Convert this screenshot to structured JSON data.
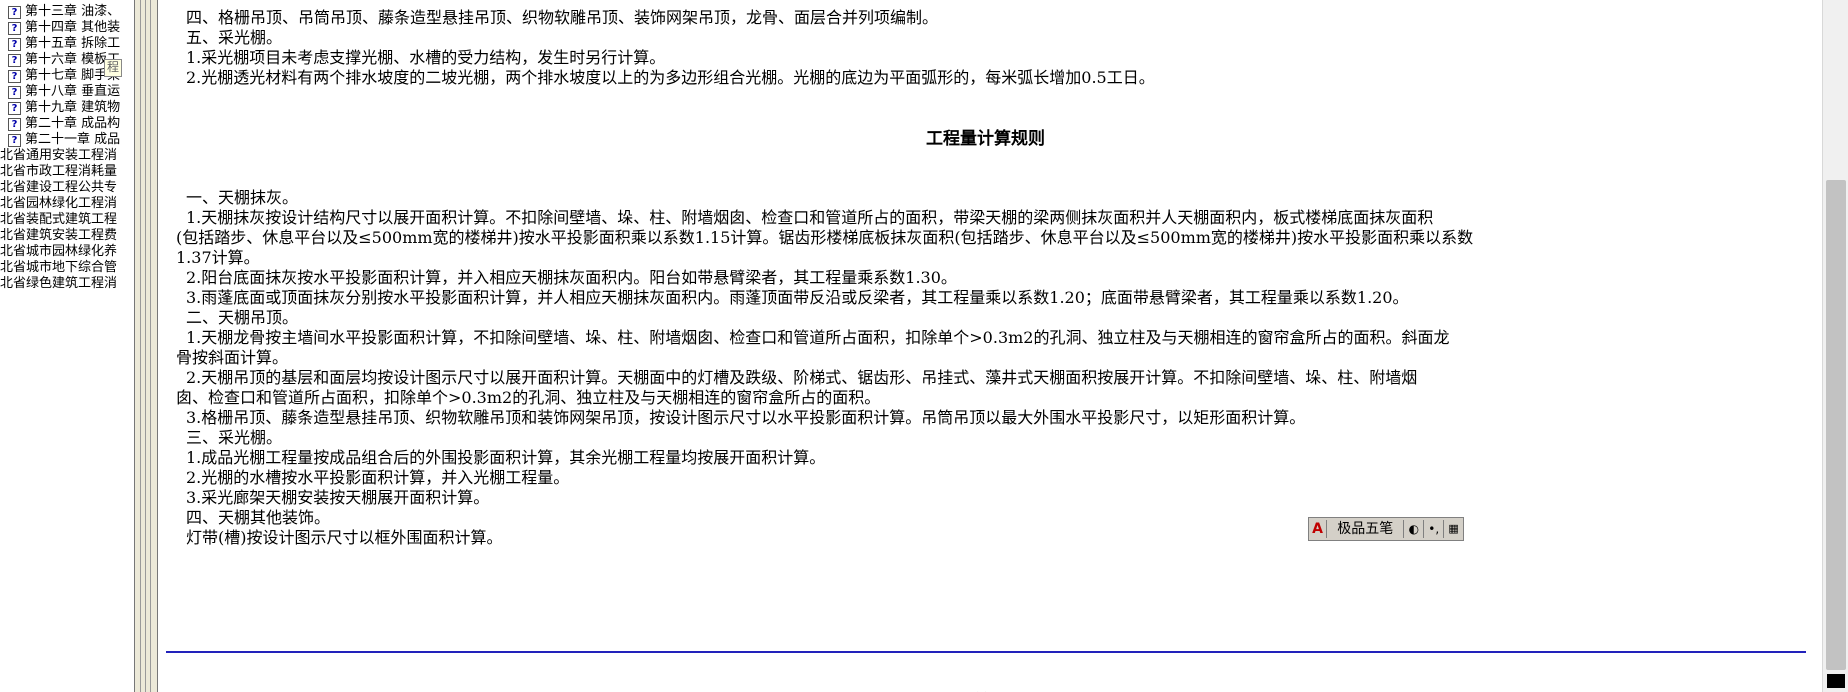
{
  "tree": {
    "chapters": [
      "第十三章 油漆、",
      "第十四章 其他装",
      "第十五章 拆除工",
      "第十六章 模板工",
      "第十七章 脚手架",
      "第十八章 垂直运",
      "第十九章 建筑物",
      "第二十章 成品构",
      "第二十一章 成品"
    ],
    "tooltip": "程",
    "provinces": [
      "北省通用安装工程消",
      "北省市政工程消耗量",
      "北省建设工程公共专",
      "北省园林绿化工程消",
      "北省装配式建筑工程",
      "北省建筑安装工程费",
      "北省城市园林绿化养",
      "北省城市地下综合管",
      "北省绿色建筑工程消"
    ]
  },
  "doc": {
    "lines": [
      "四、格栅吊顶、吊筒吊顶、藤条造型悬挂吊顶、织物软雕吊顶、装饰网架吊顶，龙骨、面层合并列项编制。",
      "五、采光棚。",
      "1.采光棚项目未考虑支撑光棚、水槽的受力结构，发生时另行计算。",
      "2.光棚透光材料有两个排水坡度的二坡光棚，两个排水坡度以上的为多边形组合光棚。光棚的底边为平面弧形的，每米弧长增加0.5工日。",
      "工程量计算规则",
      "一、天棚抹灰。",
      "1.天棚抹灰按设计结构尺寸以展开面积计算。不扣除间壁墙、垛、柱、附墙烟囱、检查口和管道所占的面积，带梁天棚的梁两侧抹灰面积并人天棚面积内，板式楼梯底面抹灰面积",
      "(包括踏步、休息平台以及≤500mm宽的楼梯井)按水平投影面积乘以系数1.15计算。锯齿形楼梯底板抹灰面积(包括踏步、休息平台以及≤500mm宽的楼梯井)按水平投影面积乘以系数",
      "1.37计算。",
      "2.阳台底面抹灰按水平投影面积计算，并入相应天棚抹灰面积内。阳台如带悬臂梁者，其工程量乘系数1.30。",
      "3.雨蓬底面或顶面抹灰分别按水平投影面积计算，并人相应天棚抹灰面积内。雨蓬顶面带反沿或反梁者，其工程量乘以系数1.20；底面带悬臂梁者，其工程量乘以系数1.20。",
      "二、天棚吊顶。",
      "1.天棚龙骨按主墙间水平投影面积计算，不扣除间壁墙、垛、柱、附墙烟囱、检查口和管道所占面积，扣除单个>0.3m2的孔洞、独立柱及与天棚相连的窗帘盒所占的面积。斜面龙",
      "骨按斜面计算。",
      "2.天棚吊顶的基层和面层均按设计图示尺寸以展开面积计算。天棚面中的灯槽及跌级、阶梯式、锯齿形、吊挂式、藻井式天棚面积按展开计算。不扣除间壁墙、垛、柱、附墙烟",
      "囱、检查口和管道所占面积，扣除单个>0.3m2的孔洞、独立柱及与天棚相连的窗帘盒所占的面积。",
      "3.格栅吊顶、藤条造型悬挂吊顶、织物软雕吊顶和装饰网架吊顶，按设计图示尺寸以水平投影面积计算。吊筒吊顶以最大外围水平投影尺寸，以矩形面积计算。",
      "三、采光棚。",
      "1.成品光棚工程量按成品组合后的外围投影面积计算，其余光棚工程量均按展开面积计算。",
      "2.光棚的水槽按水平投影面积计算，并入光棚工程量。",
      "3.采光廊架天棚安装按天棚展开面积计算。",
      "四、天棚其他装饰。",
      "灯带(槽)按设计图示尺寸以框外围面积计算。"
    ],
    "bottom_mark": "· ·"
  },
  "ime": {
    "mode": "A",
    "name": "极品五笔",
    "moon": "◐",
    "punct": "•,",
    "keyboard": "▦"
  },
  "tree_icon": "?",
  "colors": {
    "rule": "#2222bb",
    "ime_bg": "#d4d0c8"
  }
}
